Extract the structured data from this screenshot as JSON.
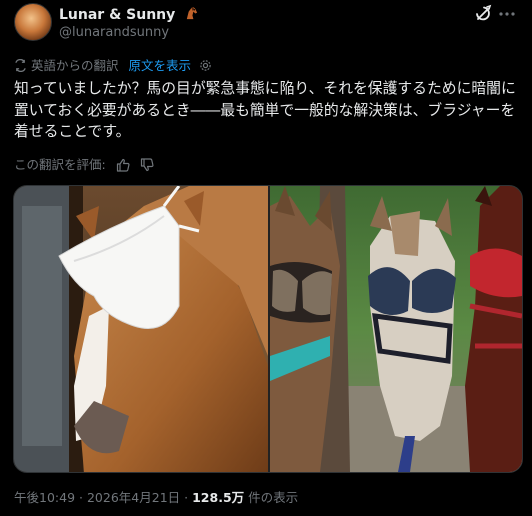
{
  "author": {
    "display_name": "Lunar & Sunny",
    "handle": "@lunarandsunny",
    "name_emoji": "horse-emoji"
  },
  "translation": {
    "note": "英語からの翻訳",
    "show_original": "原文を表示"
  },
  "tweet": {
    "text": "知っていましたか？馬の目が緊急事態に陥り、それを保護するために暗闇に置いておく必要があるとき――最も簡単で一般的な解決策は、ブラジャーを着せることです。"
  },
  "rating": {
    "label": "この翻訳を評価:"
  },
  "footer": {
    "time": "午後10:49",
    "separator": "·",
    "date": "2026年4月21日",
    "views": "128.5万",
    "views_suffix": "件の表示"
  },
  "icons": {
    "grok": "grok-icon",
    "more": "more-options-icon",
    "translate": "translate-icon",
    "settings": "gear-icon",
    "thumbs_up": "thumbs-up-icon",
    "thumbs_down": "thumbs-down-icon"
  },
  "colors": {
    "background": "#000000",
    "text": "#e7e9ea",
    "secondary": "#71767b",
    "link": "#1d9bf0"
  }
}
